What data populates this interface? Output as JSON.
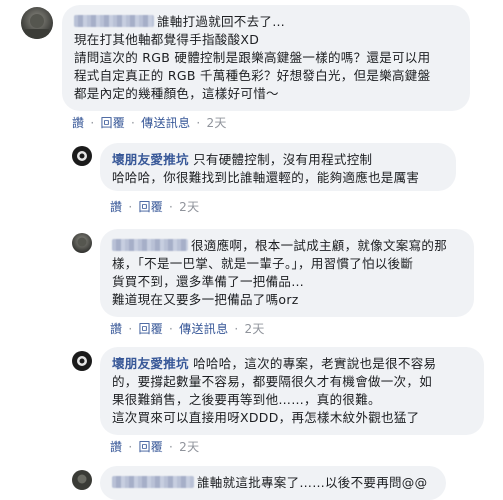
{
  "labels": {
    "reply": "回覆",
    "message": "傳送訊息",
    "separator": "·"
  },
  "comments": [
    {
      "name": "",
      "lines": [
        "誰軸打過就回不去了…",
        "現在打其他軸都覺得手指酸酸XD",
        "",
        "請問這次的 RGB 硬體控制是跟樂高鍵盤一樣的嗎？還是可以用",
        "程式自定真正的 RGB 千萬種色彩？好想發白光，但是樂高鍵盤",
        "都是內定的幾種顏色，這樣好可惜～"
      ],
      "action_first": "讚",
      "time": "2天"
    },
    {
      "name": "壞朋友愛推坑",
      "lines": [
        "只有硬體控制，沒有用程式控制",
        "哈哈哈，你很難找到比誰軸還輕的，能夠適應也是厲害"
      ],
      "action_first": "讚",
      "time": "2天"
    },
    {
      "name": "",
      "lines": [
        "很適應啊，根本一試成主顧，就像文案寫的那",
        "樣，「不是一巴掌、就是一輩子。」，用習慣了怕以後斷",
        "貨買不到，還多準備了一把備品…",
        "",
        "難道現在又要多一把備品了嗎orz"
      ],
      "action_first": "讚",
      "time": "2天"
    },
    {
      "name": "壞朋友愛推坑",
      "lines": [
        "哈哈哈，這次的專案，老實說也是很不容易",
        "的，要撐起數量不容易，都要隔很久才有機會做一次，如",
        "果很難銷售，之後要再等到他……，真的很難。",
        "",
        "這次買來可以直接用呀XDDD，再怎樣木紋外觀也猛了"
      ],
      "action_first": "讚",
      "time": "2天"
    },
    {
      "name": "",
      "lines": [
        "誰軸就這批專案了……以後不要再問@@"
      ]
    }
  ]
}
